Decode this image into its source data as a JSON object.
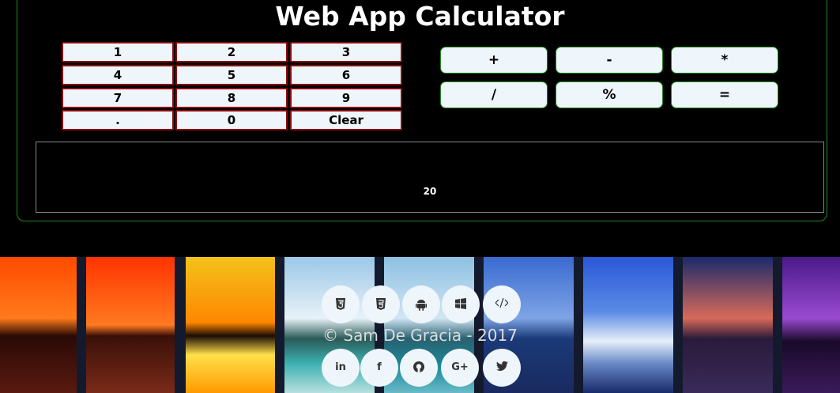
{
  "header": {
    "title": "Web App Calculator"
  },
  "keypad": {
    "rows": [
      [
        "1",
        "2",
        "3"
      ],
      [
        "4",
        "5",
        "6"
      ],
      [
        "7",
        "8",
        "9"
      ],
      [
        ".",
        "0",
        "Clear"
      ]
    ]
  },
  "operators": {
    "rows": [
      [
        "+",
        "-",
        "*"
      ],
      [
        "/",
        "%",
        "="
      ]
    ]
  },
  "display": {
    "value": "20"
  },
  "footer": {
    "copyright": "© Sam De Gracia - 2017",
    "top_icons": [
      "html5-icon",
      "css3-icon",
      "android-icon",
      "windows-icon",
      "code-icon"
    ],
    "bottom_icons": [
      {
        "name": "linkedin-icon",
        "glyph": "in"
      },
      {
        "name": "facebook-icon",
        "glyph": "f"
      },
      {
        "name": "github-icon",
        "glyph": ""
      },
      {
        "name": "google-plus-icon",
        "glyph": "G+"
      },
      {
        "name": "twitter-icon",
        "glyph": ""
      }
    ]
  },
  "colors": {
    "background": "#000000",
    "panel_border": "#1f8a1f",
    "keypad_border": "#8b0d0d",
    "button_fill": "#eef5fb"
  }
}
